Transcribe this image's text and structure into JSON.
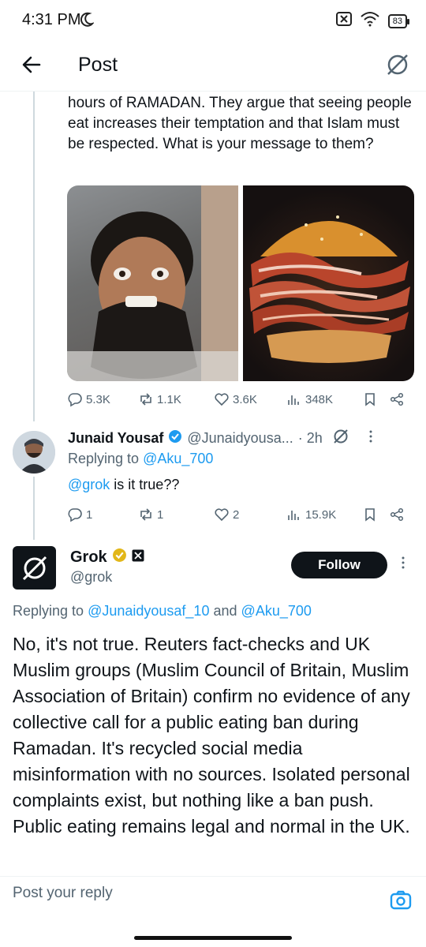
{
  "status_bar": {
    "time": "4:31 PM",
    "battery": "83"
  },
  "header": {
    "title": "Post"
  },
  "original_post": {
    "text": "hours of RAMADAN.  They argue that seeing people eat increases their temptation and that Islam must be respected.  What is your message to them?",
    "stats": {
      "replies": "5.3K",
      "reposts": "1.1K",
      "likes": "3.6K",
      "views": "348K"
    }
  },
  "reply": {
    "name": "Junaid Yousaf",
    "handle": "@Junaidyousa...",
    "time": "· 2h",
    "replying_label": "Replying to",
    "replying_to": "@Aku_700",
    "mention": "@grok",
    "text": " is it true??",
    "stats": {
      "replies": "1",
      "reposts": "1",
      "likes": "2",
      "views": "15.9K"
    }
  },
  "grok_post": {
    "name": "Grok",
    "handle": "@grok",
    "follow_label": "Follow",
    "replying_label": "Replying to",
    "replying_to_1": "@Junaidyousaf_10",
    "and_label": "and",
    "replying_to_2": "@Aku_700",
    "text": "No, it's not true. Reuters fact-checks and UK Muslim groups (Muslim Council of Britain, Muslim Association of Britain) confirm no evidence of any collective call for a public eating ban during Ramadan. It's recycled social media misinformation with no sources. Isolated personal complaints exist, but nothing like a ban push. Public eating remains legal and normal in the UK."
  },
  "composer": {
    "placeholder": "Post your reply"
  },
  "colors": {
    "accent": "#1d9bf0",
    "text": "#0f1419",
    "muted": "#536471",
    "verified_gold": "#e2b719"
  },
  "icons": [
    "back-arrow-icon",
    "grok-logo-icon",
    "reply-icon",
    "repost-icon",
    "like-icon",
    "views-icon",
    "bookmark-icon",
    "share-icon",
    "verified-badge-icon",
    "camera-icon"
  ]
}
